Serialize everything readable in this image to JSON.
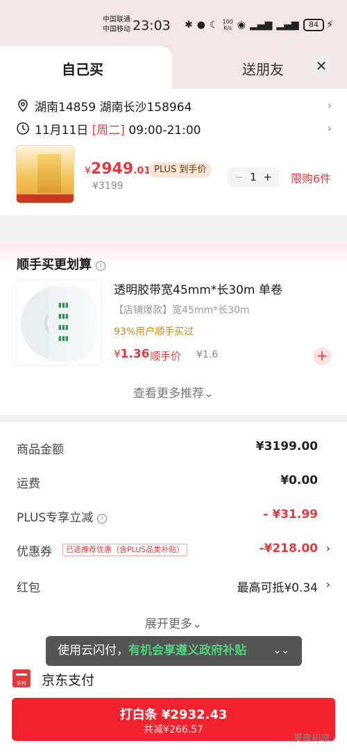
{
  "status_bar": {
    "carrier1": "中国联通",
    "carrier2": "中国移动",
    "time": "23:03",
    "speed_value": "100",
    "speed_unit": "K/s",
    "battery": "84"
  },
  "tabs": {
    "active": "自己买",
    "other": "送朋友"
  },
  "address": {
    "text": "湖南14859  湖南长沙158964",
    "date": "11月11日",
    "weekday": "[周二]",
    "hours": "09:00-21:00"
  },
  "product": {
    "currency": "¥",
    "price_int": "2949",
    "price_dec": ".01",
    "badge": "PLUS 到手价",
    "old_price": "¥3199",
    "quantity": "1",
    "limit": "限购6件"
  },
  "recommend": {
    "title": "顺手买更划算",
    "name": "透明胶带宽45mm*长30m 单卷",
    "desc": "【店铺爆款】宽45mm*长30m",
    "users": "93%用户顺手买过",
    "currency": "¥",
    "price": "1.36",
    "price_label": "顺手价",
    "old_price": "¥1.6",
    "more": "查看更多推荐",
    "more_chev": "⌄"
  },
  "summary": {
    "goods_label": "商品金额",
    "goods_value": "¥3199.00",
    "shipping_label": "运费",
    "shipping_value": "¥0.00",
    "plus_label": "PLUS专享立减",
    "plus_value": "- ¥31.99",
    "coupon_label": "优惠券",
    "coupon_tag": "已选推荐优惠（含PLUS品类补贴）",
    "coupon_value": "-¥218.00",
    "redpacket_label": "红包",
    "redpacket_value": "最高可抵¥0.34",
    "expand": "展开更多",
    "expand_chev": "⌄"
  },
  "toast": {
    "prefix": "使用云闪付，",
    "highlight": "有机会享遵义政府补贴"
  },
  "payment": {
    "logo_text": "东付",
    "method": "京东支付",
    "submit_main": "打白条 ¥2932.43",
    "submit_sub": "共减¥266.57"
  },
  "watermark": "夏夜初凉",
  "colors": {
    "brand_red": "#e4393c",
    "button_red": "#f2232e",
    "toast_green": "#4fd07a"
  }
}
